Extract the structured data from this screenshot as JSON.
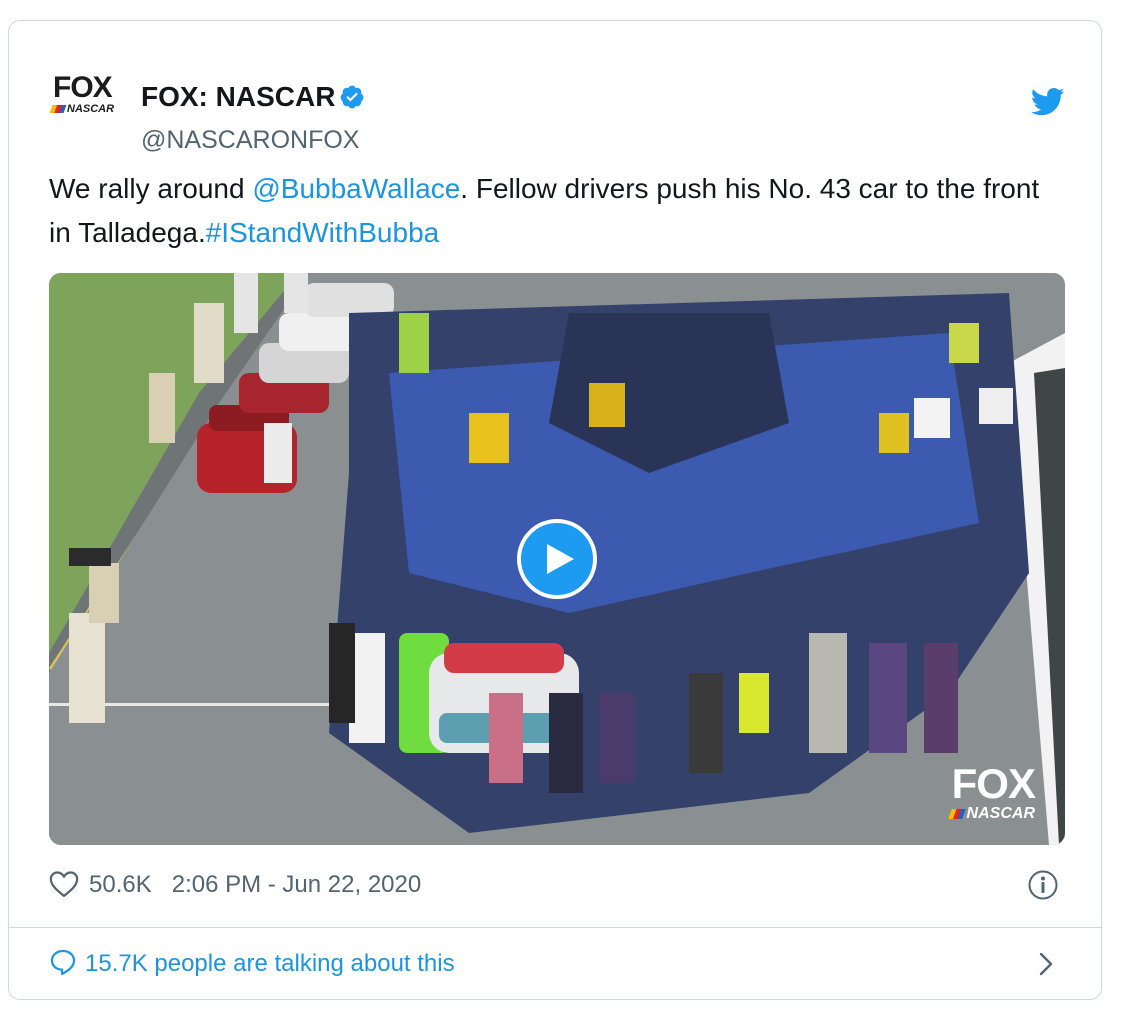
{
  "author": {
    "display_name": "FOX: NASCAR",
    "handle": "@NASCARONFOX",
    "avatar_logo_top": "FOX",
    "avatar_logo_bottom": "NASCAR",
    "verified": true
  },
  "platform_icon": "twitter-bird-icon",
  "tweet": {
    "text_before": "We rally around ",
    "mention": "@BubbaWallace",
    "text_after": ". Fellow drivers push his No. 43 car to the front in Talladega.",
    "hashtag": "#IStandWithBubba"
  },
  "media": {
    "type": "video",
    "watermark_top": "FOX",
    "watermark_bottom": "NASCAR",
    "play_icon": "play-icon"
  },
  "meta": {
    "likes": "50.6K",
    "timestamp": "2:06 PM - Jun 22, 2020",
    "info_icon": "info-icon"
  },
  "conversation": {
    "label": "15.7K people are talking about this",
    "icon": "speech-bubble-icon",
    "chevron": "chevron-right-icon"
  },
  "colors": {
    "link": "#1b95e0",
    "text": "#14171a",
    "muted": "#536471",
    "border": "#cfd9de",
    "verified": "#1d9bf0"
  }
}
